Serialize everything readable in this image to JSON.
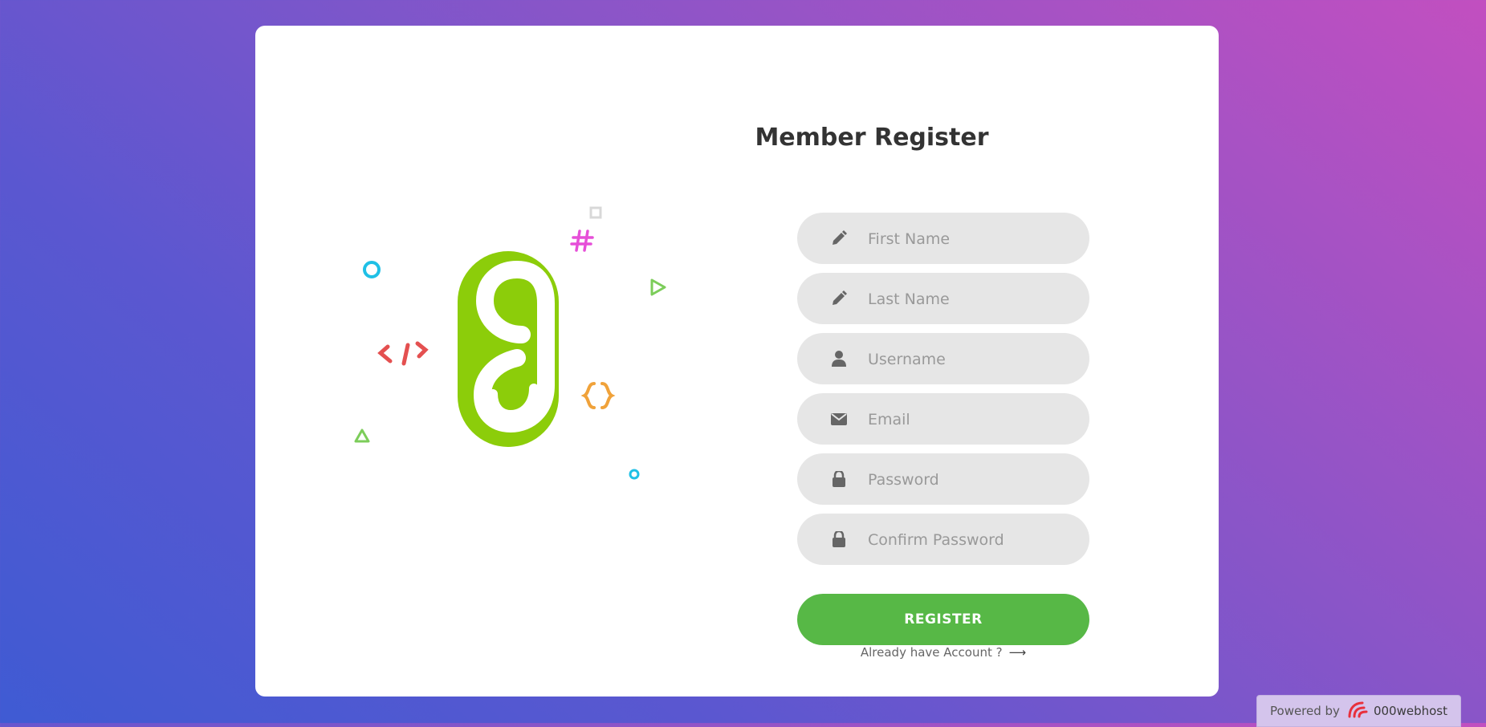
{
  "form": {
    "title": "Member Register",
    "fields": [
      {
        "name": "first_name",
        "placeholder": "First Name",
        "icon": "pencil-icon",
        "value": ""
      },
      {
        "name": "last_name",
        "placeholder": "Last Name",
        "icon": "pencil-icon",
        "value": ""
      },
      {
        "name": "username",
        "placeholder": "Username",
        "icon": "user-icon",
        "value": ""
      },
      {
        "name": "email",
        "placeholder": "Email",
        "icon": "envelope-icon",
        "value": ""
      },
      {
        "name": "password",
        "placeholder": "Password",
        "icon": "lock-icon",
        "value": ""
      },
      {
        "name": "confirm_password",
        "placeholder": "Confirm Password",
        "icon": "lock-icon",
        "value": ""
      }
    ],
    "submit_label": "REGISTER",
    "login_link_label": "Already have Account ?",
    "login_link_icon": "arrow-right-icon"
  },
  "footer": {
    "powered_label": "Powered by",
    "brand": "000webhost"
  },
  "colors": {
    "accent_green": "#57b846",
    "logo_green": "#8ccd0a",
    "field_bg": "#e6e6e6",
    "title_text": "#333333"
  }
}
